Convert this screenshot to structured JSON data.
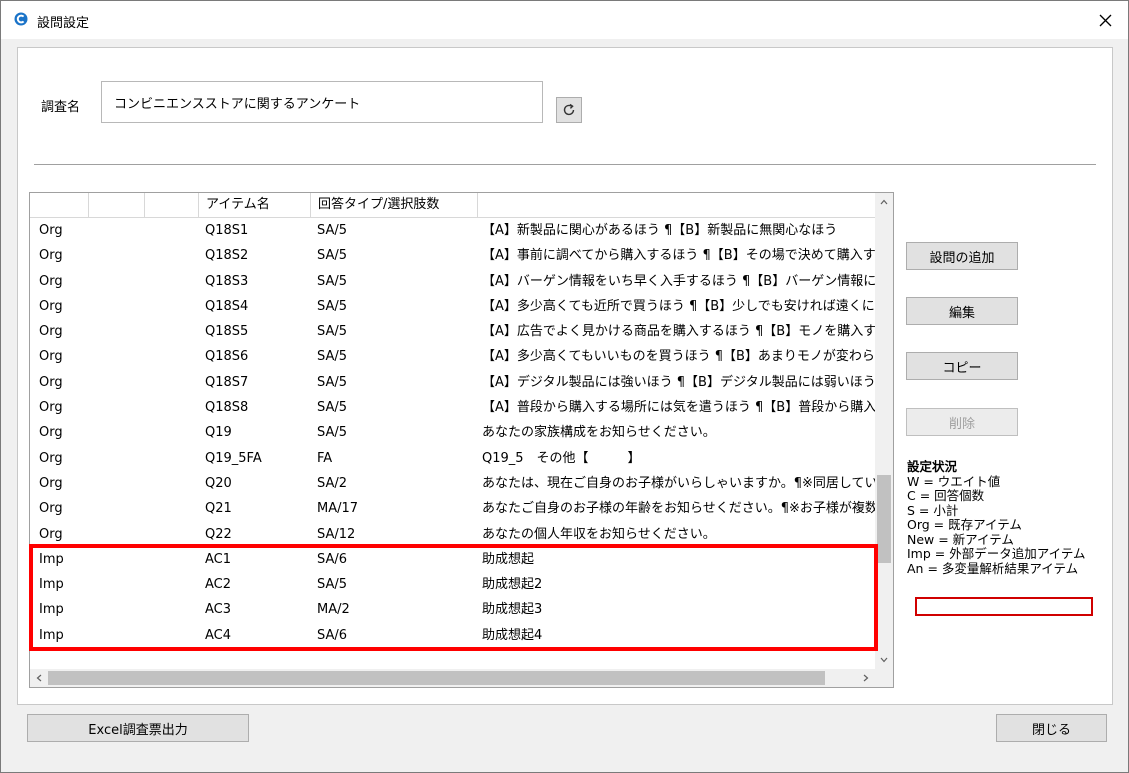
{
  "window": {
    "title": "設問設定"
  },
  "survey": {
    "label": "調査名",
    "name": "コンビニエンスストアに関するアンケート"
  },
  "grid": {
    "headers": [
      "",
      "",
      "",
      "アイテム名",
      "回答タイプ/選択肢数",
      ""
    ],
    "rows": [
      {
        "type": "Org",
        "name": "Q18S1",
        "answer": "SA/5",
        "text": "【A】新製品に関心があるほう ¶【B】新製品に無関心なほう"
      },
      {
        "type": "Org",
        "name": "Q18S2",
        "answer": "SA/5",
        "text": "【A】事前に調べてから購入するほう ¶【B】その場で決めて購入するほう"
      },
      {
        "type": "Org",
        "name": "Q18S3",
        "answer": "SA/5",
        "text": "【A】バーゲン情報をいち早く入手するほう ¶【B】バーゲン情報には興味がな"
      },
      {
        "type": "Org",
        "name": "Q18S4",
        "answer": "SA/5",
        "text": "【A】多少高くても近所で買うほう ¶【B】少しでも安ければ遠くに出かけて購"
      },
      {
        "type": "Org",
        "name": "Q18S5",
        "answer": "SA/5",
        "text": "【A】広告でよく見かける商品を購入するほう ¶【B】モノを購入する際、広告"
      },
      {
        "type": "Org",
        "name": "Q18S6",
        "answer": "SA/5",
        "text": "【A】多少高くてもいいものを買うほう ¶【B】あまりモノが変わらなければ、安"
      },
      {
        "type": "Org",
        "name": "Q18S7",
        "answer": "SA/5",
        "text": "【A】デジタル製品には強いほう ¶【B】デジタル製品には弱いほう"
      },
      {
        "type": "Org",
        "name": "Q18S8",
        "answer": "SA/5",
        "text": "【A】普段から購入する場所には気を遣うほう ¶【B】普段から購入する場所"
      },
      {
        "type": "Org",
        "name": "Q19",
        "answer": "SA/5",
        "text": "あなたの家族構成をお知らせください。"
      },
      {
        "type": "Org",
        "name": "Q19_5FA",
        "answer": "FA",
        "text": "Q19_5　その他【　　　】"
      },
      {
        "type": "Org",
        "name": "Q20",
        "answer": "SA/2",
        "text": "あなたは、現在ご自身のお子様がいらしゃいますか。¶※同居しているかどうか"
      },
      {
        "type": "Org",
        "name": "Q21",
        "answer": "MA/17",
        "text": "あなたご自身のお子様の年齢をお知らせください。¶※お子様が複数いらっし"
      },
      {
        "type": "Org",
        "name": "Q22",
        "answer": "SA/12",
        "text": "あなたの個人年収をお知らせください。"
      },
      {
        "type": "Imp",
        "name": "AC1",
        "answer": "SA/6",
        "text": "助成想起"
      },
      {
        "type": "Imp",
        "name": "AC2",
        "answer": "SA/5",
        "text": "助成想起2"
      },
      {
        "type": "Imp",
        "name": "AC3",
        "answer": "MA/2",
        "text": "助成想起3"
      },
      {
        "type": "Imp",
        "name": "AC4",
        "answer": "SA/6",
        "text": "助成想起4"
      }
    ],
    "vscroll_position": 0.75,
    "vscroll_visible_fraction": 0.2,
    "hscroll_position": 0.0,
    "hscroll_visible_fraction": 0.96
  },
  "actions": {
    "add": "設問の追加",
    "edit": "編集",
    "copy": "コピー",
    "delete": "削除"
  },
  "legend": {
    "title": "設定状況",
    "items": [
      "W = ウエイト値",
      "C = 回答個数",
      "S = 小計",
      "Org = 既存アイテム",
      "New = 新アイテム",
      "Imp = 外部データ追加アイテム",
      "An = 多変量解析結果アイテム"
    ]
  },
  "footer": {
    "excel": "Excel調査票出力",
    "close": "閉じる"
  },
  "colors": {
    "highlight": "#ff0000",
    "accent": "#1a73c8"
  },
  "icons": {
    "app": "app-logo-icon",
    "close": "close-icon",
    "refresh": "refresh-icon"
  }
}
